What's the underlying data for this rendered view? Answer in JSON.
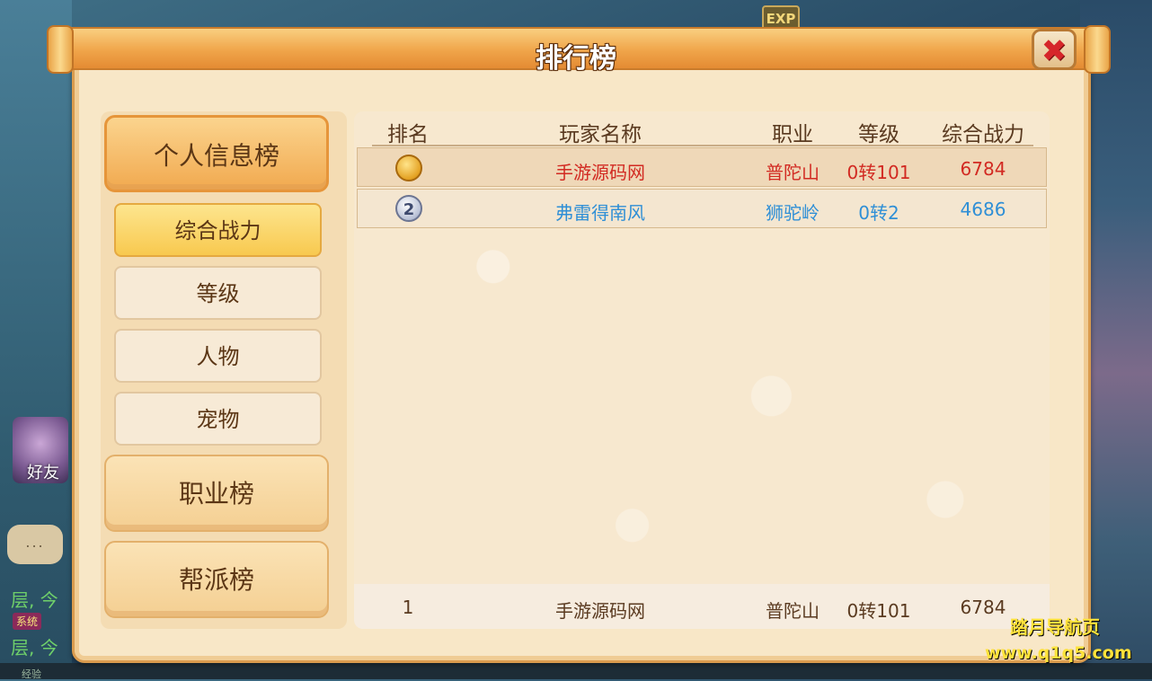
{
  "game_bg": {
    "exp_label": "EXP",
    "friend_label": "好友",
    "chat_dots": "...",
    "side_text_1": "层, 今",
    "system_tag": "系统",
    "side_text_2": "层, 今",
    "bottom_text": "经验"
  },
  "panel": {
    "title": "排行榜",
    "close_symbol": "✖"
  },
  "menu": {
    "personal": "个人信息榜",
    "sub_tabs": [
      "综合战力",
      "等级",
      "人物",
      "宠物"
    ],
    "profession": "职业榜",
    "guild": "帮派榜"
  },
  "table": {
    "headers": [
      "排名",
      "玩家名称",
      "职业",
      "等级",
      "综合战力"
    ],
    "rows": [
      {
        "rank": "",
        "name": "手游源码网",
        "job": "普陀山",
        "level": "0转101",
        "power": "6784"
      },
      {
        "rank": "2",
        "name": "弗雷得南风",
        "job": "狮驼岭",
        "level": "0转2",
        "power": "4686"
      }
    ],
    "self_row": {
      "rank": "1",
      "name": "手游源码网",
      "job": "普陀山",
      "level": "0转101",
      "power": "6784"
    }
  },
  "colors": {
    "top1": "#d22a22",
    "top2": "#2f8fd6",
    "accent": "#f1a94f"
  },
  "watermark": {
    "line1": "踏月导航页",
    "line2": "www.q1q5.com"
  }
}
